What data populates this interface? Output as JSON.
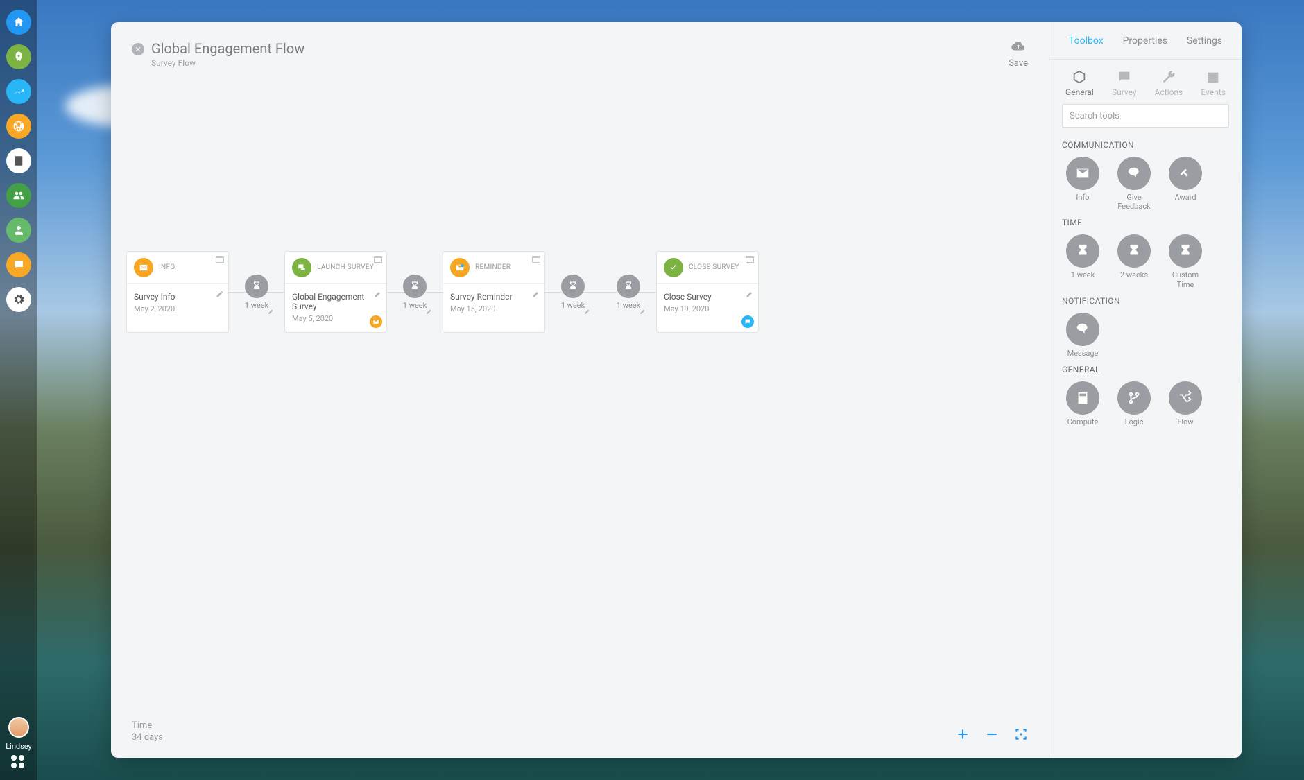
{
  "sidebar": {
    "user": "Lindsey"
  },
  "header": {
    "title": "Global Engagement Flow",
    "subtitle": "Survey Flow",
    "save": "Save"
  },
  "flow": {
    "cards": [
      {
        "type": "INFO",
        "title": "Survey Info",
        "date": "May 2, 2020"
      },
      {
        "type": "LAUNCH SURVEY",
        "title": "Global Engagement Survey",
        "date": "May 5, 2020"
      },
      {
        "type": "REMINDER",
        "title": "Survey Reminder",
        "date": "May 15, 2020"
      },
      {
        "type": "CLOSE SURVEY",
        "title": "Close Survey",
        "date": "May 19, 2020"
      }
    ],
    "spacers": [
      {
        "label": "1 week"
      },
      {
        "label": "1 week"
      },
      {
        "label": "1 week"
      },
      {
        "label": "1 week"
      }
    ]
  },
  "footer": {
    "label": "Time",
    "value": "34 days"
  },
  "toolbox": {
    "tabs": {
      "toolbox": "Toolbox",
      "properties": "Properties",
      "settings": "Settings"
    },
    "toolTabs": {
      "general": "General",
      "survey": "Survey",
      "actions": "Actions",
      "events": "Events"
    },
    "searchPlaceholder": "Search tools",
    "sections": {
      "communication": {
        "title": "COMMUNICATION",
        "items": {
          "info": "Info",
          "feedback": "Give Feedback",
          "award": "Award"
        }
      },
      "time": {
        "title": "TIME",
        "items": {
          "w1": "1 week",
          "w2": "2 weeks",
          "custom": "Custom Time"
        }
      },
      "notification": {
        "title": "NOTIFICATION",
        "items": {
          "message": "Message"
        }
      },
      "general": {
        "title": "GENERAL",
        "items": {
          "compute": "Compute",
          "logic": "Logic",
          "flow": "Flow"
        }
      }
    }
  }
}
